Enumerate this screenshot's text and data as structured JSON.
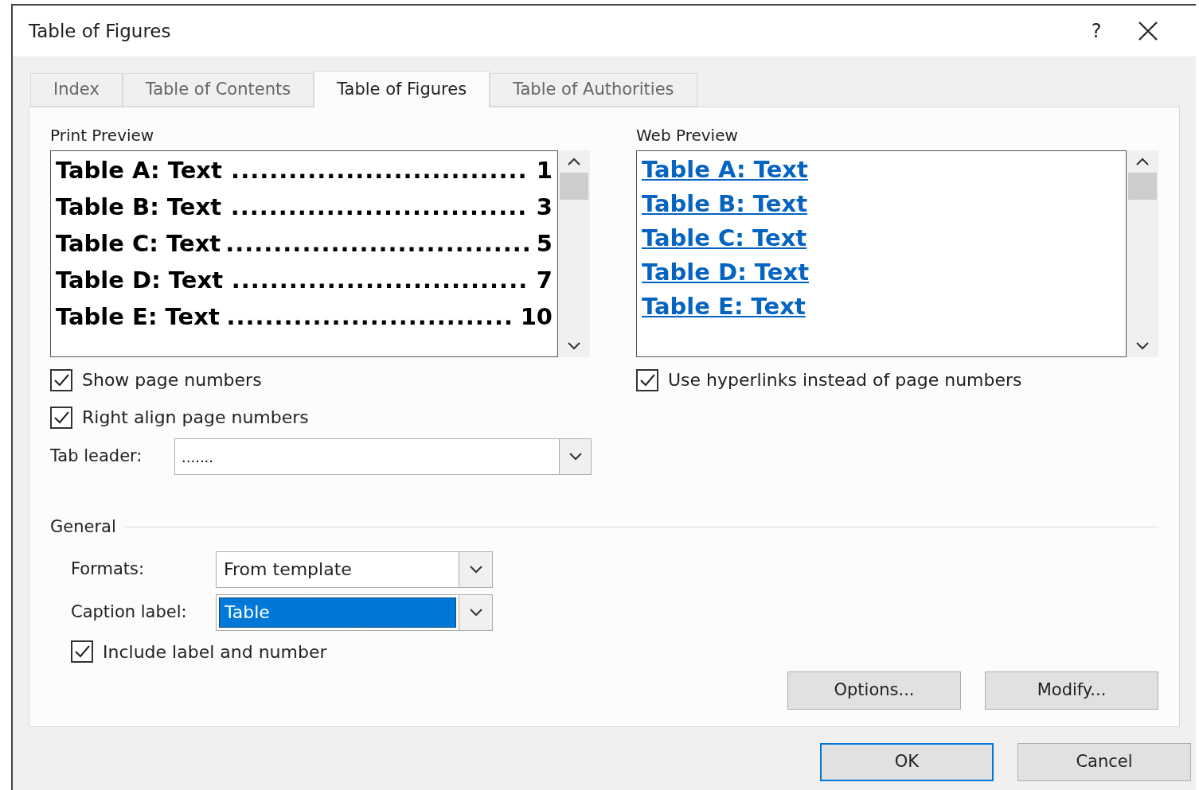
{
  "window": {
    "title": "Table of Figures",
    "help": "?"
  },
  "tabs": [
    {
      "label": "Index",
      "selected": false
    },
    {
      "label": "Table of Contents",
      "selected": false
    },
    {
      "label": "Table of Figures",
      "selected": true
    },
    {
      "label": "Table of Authorities",
      "selected": false
    }
  ],
  "print_preview": {
    "label": "Print Preview",
    "entries": [
      {
        "label": "Table A: Text",
        "leader": "...............................",
        "page": "1"
      },
      {
        "label": "Table B: Text",
        "leader": "...............................",
        "page": "3"
      },
      {
        "label": "Table C: Text",
        "leader": "................................",
        "page": "5"
      },
      {
        "label": "Table D: Text",
        "leader": "...............................",
        "page": "7"
      },
      {
        "label": "Table E: Text",
        "leader": "..............................",
        "page": "10"
      }
    ]
  },
  "print_options": [
    {
      "label": "Show page numbers",
      "checked": true
    },
    {
      "label": "Right align page numbers",
      "checked": true
    }
  ],
  "tab_leader": {
    "label": "Tab leader:",
    "value": "......."
  },
  "web_preview": {
    "label": "Web Preview",
    "entries": [
      "Table A: Text",
      "Table B: Text",
      "Table C: Text",
      "Table D: Text",
      "Table E: Text"
    ]
  },
  "web_options": [
    {
      "label": "Use hyperlinks instead of page numbers",
      "checked": true
    }
  ],
  "general": {
    "title": "General",
    "formats": {
      "label": "Formats:",
      "value": "From template",
      "highlighted": false
    },
    "caption_label": {
      "label": "Caption label:",
      "value": "Table",
      "highlighted": true
    },
    "include_label": {
      "label": "Include label and number",
      "checked": true
    }
  },
  "panel_buttons": [
    "Options...",
    "Modify..."
  ],
  "footer_buttons": [
    {
      "label": "OK",
      "default": true
    },
    {
      "label": "Cancel",
      "default": false
    }
  ]
}
